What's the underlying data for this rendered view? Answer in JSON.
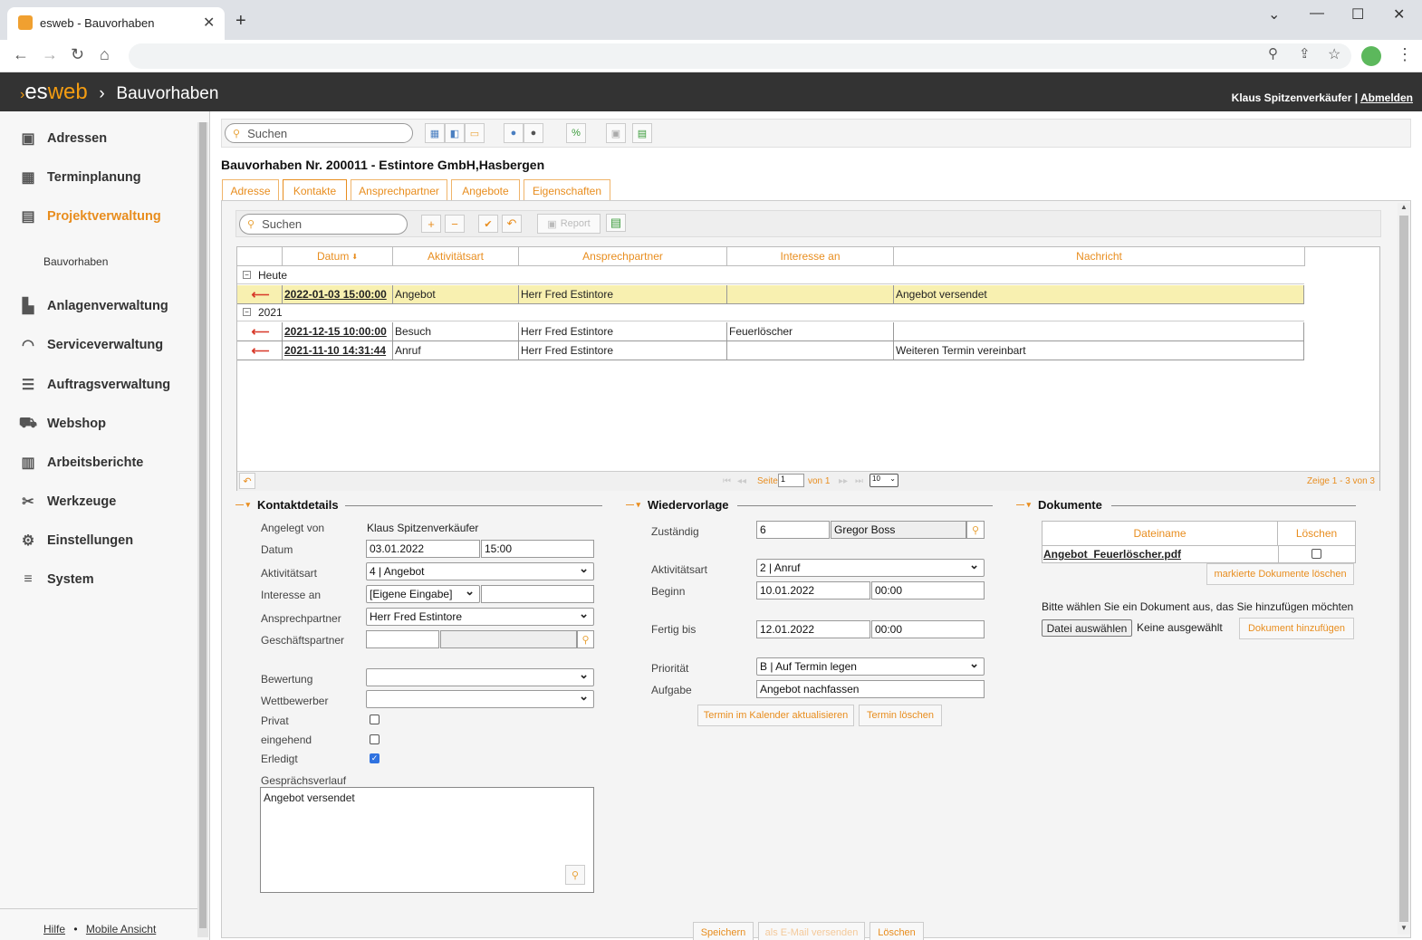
{
  "browser": {
    "tab_title": "esweb - Bauvorhaben",
    "new_tab": "+",
    "close_tab": "✕"
  },
  "app": {
    "logo_es": "es",
    "logo_web": "web",
    "section": "Bauvorhaben",
    "user": "Klaus Spitzenverkäufer",
    "separator": "|",
    "logout": "Abmelden",
    "accent_color": "#e88d1e"
  },
  "sidebar": {
    "items": [
      {
        "label": "Adressen",
        "icon": "address-book-icon"
      },
      {
        "label": "Terminplanung",
        "icon": "calendar-icon"
      },
      {
        "label": "Projektverwaltung",
        "icon": "project-icon"
      },
      {
        "label": "Anlagenverwaltung",
        "icon": "factory-icon"
      },
      {
        "label": "Serviceverwaltung",
        "icon": "headset-icon"
      },
      {
        "label": "Auftragsverwaltung",
        "icon": "list-icon"
      },
      {
        "label": "Webshop",
        "icon": "cart-icon"
      },
      {
        "label": "Arbeitsberichte",
        "icon": "clipboard-icon"
      },
      {
        "label": "Werkzeuge",
        "icon": "tools-icon"
      },
      {
        "label": "Einstellungen",
        "icon": "gears-icon"
      },
      {
        "label": "System",
        "icon": "database-icon"
      }
    ],
    "sub_item": "Bauvorhaben",
    "footer_help": "Hilfe",
    "footer_dot": "•",
    "footer_mobile": "Mobile Ansicht"
  },
  "toolbar": {
    "search_placeholder": "Suchen"
  },
  "page_title": "Bauvorhaben Nr. 200011 - Estintore GmbH,Hasbergen",
  "tabs": [
    "Adresse",
    "Kontakte",
    "Ansprechpartner",
    "Angebote",
    "Eigenschaften"
  ],
  "grid_toolbar": {
    "search_placeholder": "Suchen",
    "add": "+",
    "remove": "−",
    "confirm": "✔",
    "undo": "↶",
    "report": "Report"
  },
  "grid": {
    "headers": [
      "Datum",
      "Aktivitätsart",
      "Ansprechpartner",
      "Interesse an",
      "Nachricht"
    ],
    "sort_indicator": "⬇",
    "groups": [
      {
        "label": "Heute",
        "rows": [
          {
            "datum": "2022-01-03 15:00:00",
            "art": "Angebot",
            "partner": "Herr Fred Estintore",
            "interesse": "",
            "nachricht": "Angebot versendet"
          }
        ]
      },
      {
        "label": "2021",
        "rows": [
          {
            "datum": "2021-12-15 10:00:00",
            "art": "Besuch",
            "partner": "Herr Fred Estintore",
            "interesse": "Feuerlöscher",
            "nachricht": ""
          },
          {
            "datum": "2021-11-10 14:31:44",
            "art": "Anruf",
            "partner": "Herr Fred Estintore",
            "interesse": "",
            "nachricht": "Weiteren Termin vereinbart"
          }
        ]
      }
    ],
    "pager": {
      "page_label": "Seite",
      "page_value": "1",
      "of_label": "von 1",
      "page_size": "10",
      "summary": "Zeige 1 - 3 von 3"
    }
  },
  "kontaktdetails": {
    "title": "Kontaktdetails",
    "angelegt_label": "Angelegt von",
    "angelegt_value": "Klaus Spitzenverkäufer",
    "datum_label": "Datum",
    "datum_value": "03.01.2022",
    "zeit_value": "15:00",
    "art_label": "Aktivitätsart",
    "art_value": "4 | Angebot",
    "interesse_label": "Interesse an",
    "interesse_value": "[Eigene Eingabe]",
    "ansprech_label": "Ansprechpartner",
    "ansprech_value": "Herr Fred Estintore",
    "geschaeft_label": "Geschäftspartner",
    "bewertung_label": "Bewertung",
    "wettbewerber_label": "Wettbewerber",
    "privat_label": "Privat",
    "eingehend_label": "eingehend",
    "erledigt_label": "Erledigt",
    "verlauf_label": "Gesprächsverlauf",
    "verlauf_value": "Angebot versendet"
  },
  "wiedervorlage": {
    "title": "Wiedervorlage",
    "zustaendig_label": "Zuständig",
    "zustaendig_id": "6",
    "zustaendig_name": "Gregor Boss",
    "art_label": "Aktivitätsart",
    "art_value": "2 | Anruf",
    "beginn_label": "Beginn",
    "beginn_date": "10.01.2022",
    "beginn_time": "00:00",
    "fertig_label": "Fertig bis",
    "fertig_date": "12.01.2022",
    "fertig_time": "00:00",
    "prio_label": "Priorität",
    "prio_value": "B | Auf Termin legen",
    "aufgabe_label": "Aufgabe",
    "aufgabe_value": "Angebot nachfassen",
    "btn_kalender": "Termin im Kalender aktualisieren",
    "btn_loeschen": "Termin löschen"
  },
  "dokumente": {
    "title": "Dokumente",
    "col_name": "Dateiname",
    "col_delete": "Löschen",
    "file": "Angebot_Feuerlöscher.pdf",
    "btn_delete_marked": "markierte Dokumente löschen",
    "hint": "Bitte wählen Sie ein Dokument aus, das Sie hinzufügen möchten",
    "btn_choose": "Datei auswählen",
    "none_chosen": "Keine ausgewählt",
    "btn_add": "Dokument hinzufügen"
  },
  "footer_buttons": {
    "save": "Speichern",
    "email": "als E-Mail versenden",
    "delete": "Löschen"
  }
}
